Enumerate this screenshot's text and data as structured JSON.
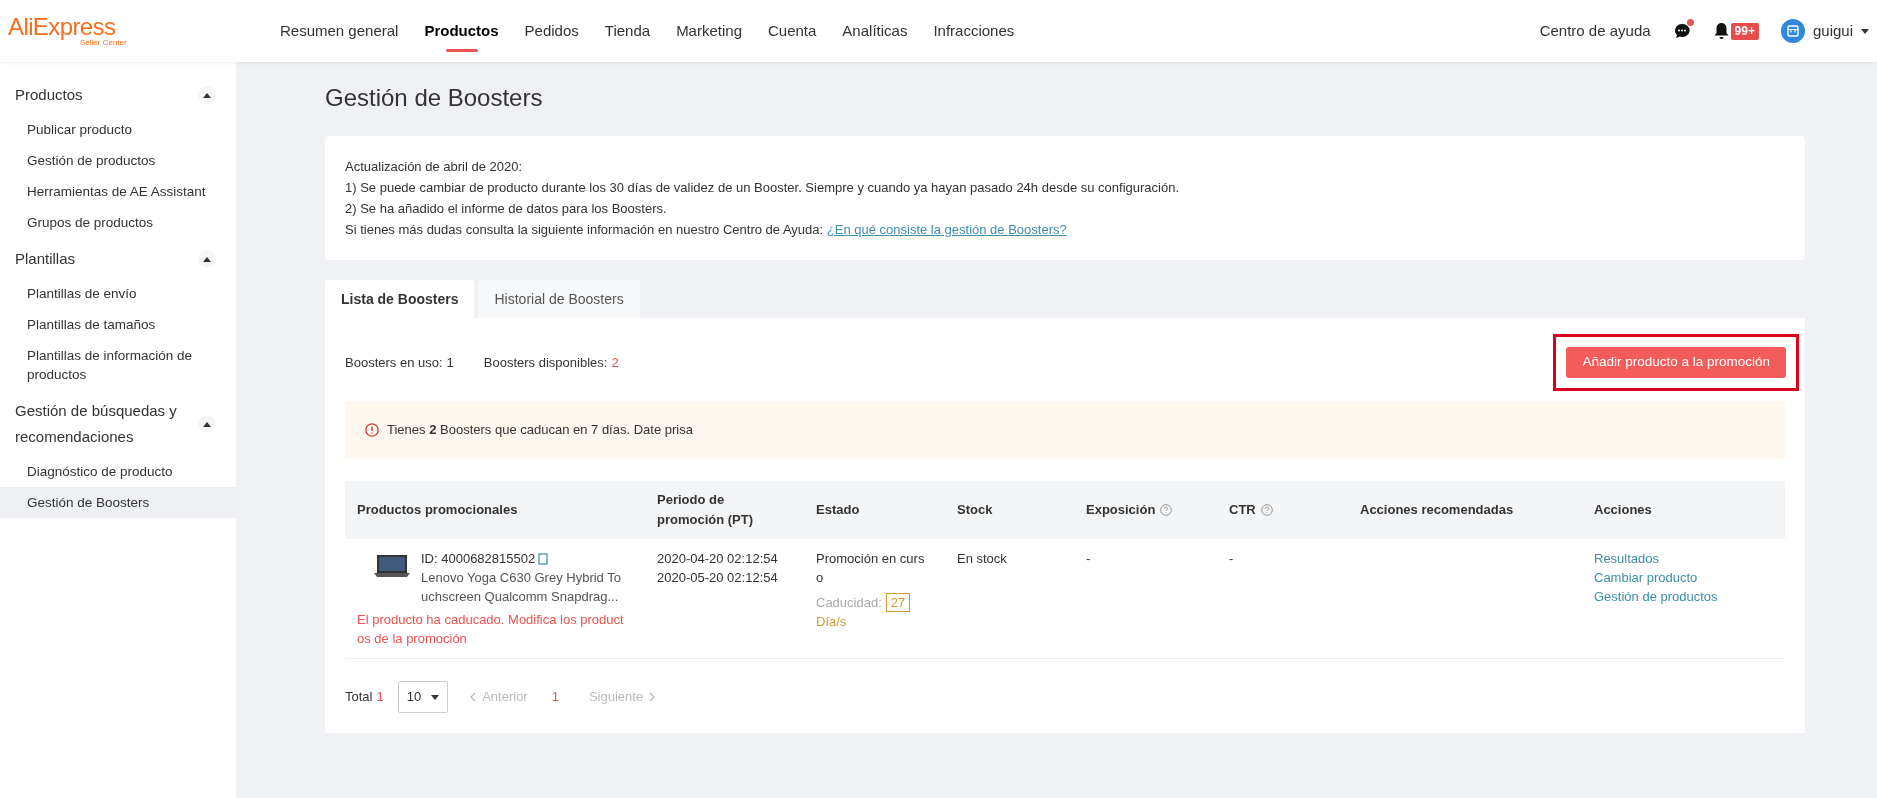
{
  "header": {
    "logo": "AliExpress",
    "logo_sub": "Seller Center",
    "nav": [
      {
        "label": "Resumen general",
        "selected": false
      },
      {
        "label": "Productos",
        "selected": true
      },
      {
        "label": "Pedidos",
        "selected": false
      },
      {
        "label": "Tienda",
        "selected": false
      },
      {
        "label": "Marketing",
        "selected": false
      },
      {
        "label": "Cuenta",
        "selected": false
      },
      {
        "label": "Analíticas",
        "selected": false
      },
      {
        "label": "Infracciones",
        "selected": false
      }
    ],
    "help": "Centro de ayuda",
    "messages_unread": true,
    "notifications_badge": "99+",
    "user": "guigui"
  },
  "sidebar": {
    "groups": [
      {
        "title": "Productos",
        "expanded": true,
        "children": [
          {
            "label": "Publicar producto",
            "selected": false
          },
          {
            "label": "Gestión de productos",
            "selected": false
          },
          {
            "label": "Herramientas de AE Assistant",
            "selected": false
          },
          {
            "label": "Grupos de productos",
            "selected": false
          }
        ]
      },
      {
        "title": "Plantillas",
        "expanded": true,
        "children": [
          {
            "label": "Plantillas de envío",
            "selected": false
          },
          {
            "label": "Plantillas de tamaños",
            "selected": false
          },
          {
            "label": "Plantillas de información de productos",
            "selected": false
          }
        ]
      },
      {
        "title": "Gestión de búsquedas y recomendaciones",
        "expanded": true,
        "children": [
          {
            "label": "Diagnóstico de producto",
            "selected": false
          },
          {
            "label": "Gestión de Boosters",
            "selected": true
          }
        ]
      }
    ]
  },
  "page_title": "Gestión de Boosters",
  "notice": {
    "lines": [
      "Actualización de abril de 2020:",
      "1) Se puede cambiar de producto durante los 30 días de validez de un Booster. Siempre y cuando ya hayan pasado 24h desde su configuración.",
      "2) Se ha añadido el informe de datos para los Boosters."
    ],
    "help_text": "Si tienes más dudas consulta la siguiente información en nuestro Centro de Ayuda:",
    "help_link": "¿En qué consiste la gestión de Boosters?"
  },
  "tabs": [
    {
      "label": "Lista de Boosters",
      "selected": true
    },
    {
      "label": "Historial de Boosters",
      "selected": false
    }
  ],
  "stats": [
    {
      "label": "Boosters en uso:",
      "value": "1",
      "kind": "normal"
    },
    {
      "label": "Boosters disponibles:",
      "value": "2",
      "kind": "accent"
    }
  ],
  "add_button": {
    "label": "Añadir producto a la promoción",
    "highlighted": true
  },
  "warning": "Tienes **2** Boosters que caducan en 7 días. Date prisa",
  "table": {
    "columns": [
      {
        "label": "Productos promocionales",
        "help": false
      },
      {
        "label": "Periodo de promoción (PT)",
        "help": false
      },
      {
        "label": "Estado",
        "help": false
      },
      {
        "label": "Stock",
        "help": false
      },
      {
        "label": "Exposición",
        "help": true
      },
      {
        "label": "CTR",
        "help": true
      },
      {
        "label": "Acciones recomendadas",
        "help": false
      },
      {
        "label": "Acciones",
        "help": false
      }
    ],
    "rows": [
      {
        "id": "ID: 4000682815502",
        "name": "Lenovo Yoga C630 Grey Hybrid Touchscreen Qualcomm Snapdrag...",
        "error": "El producto ha caducado. Modifica los productos de la promoción",
        "start": "2020-04-20 02:12:54",
        "end": "2020-05-20 02:12:54",
        "status": "Promoción en curso",
        "expiry_label": "Caducidad:",
        "expiry_days": "27",
        "expiry_unit": "Día/s",
        "stock": "En stock",
        "exposure": "-",
        "ctr": "-",
        "actions": [
          "Resultados",
          "Cambiar producto",
          "Gestión de productos"
        ]
      }
    ]
  },
  "pagination": {
    "total_label": "Total",
    "total": "1",
    "page_size": "10",
    "prev": "Anterior",
    "pages": [
      {
        "label": "1",
        "selected": true
      }
    ],
    "next": "Siguiente"
  }
}
